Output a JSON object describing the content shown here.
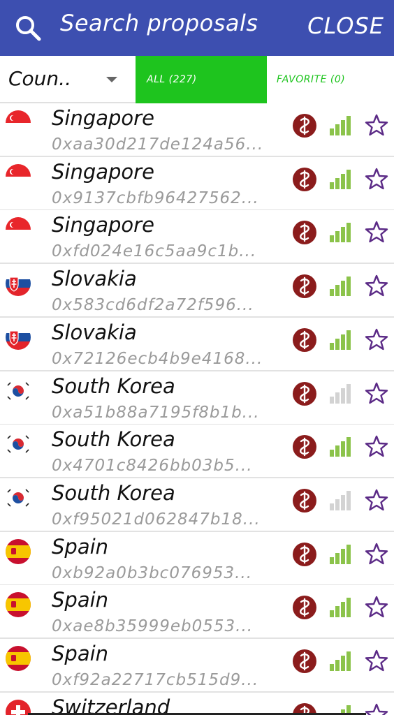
{
  "header": {
    "title": "Search proposals",
    "close_label": "CLOSE",
    "bg_color": "#3d4fb0"
  },
  "filters": {
    "country_select": "Coun..",
    "tab_all": "ALL (227)",
    "tab_favorite": "FAVORITE (0)",
    "active_color": "#1ec41e"
  },
  "proposals": [
    {
      "country": "Singapore",
      "address": "0xaa30d217de124a56...",
      "flag": "singapore",
      "signal_level": 4,
      "favorite": false
    },
    {
      "country": "Singapore",
      "address": "0x9137cbfb96427562...",
      "flag": "singapore",
      "signal_level": 4,
      "favorite": false
    },
    {
      "country": "Singapore",
      "address": "0xfd024e16c5aa9c1b...",
      "flag": "singapore",
      "signal_level": 4,
      "favorite": false
    },
    {
      "country": "Slovakia",
      "address": "0x583cd6df2a72f596...",
      "flag": "slovakia",
      "signal_level": 4,
      "favorite": false
    },
    {
      "country": "Slovakia",
      "address": "0x72126ecb4b9e4168...",
      "flag": "slovakia",
      "signal_level": 4,
      "favorite": false
    },
    {
      "country": "South Korea",
      "address": "0xa51b88a7195f8b1b...",
      "flag": "south-korea",
      "signal_level": 0,
      "favorite": false
    },
    {
      "country": "South Korea",
      "address": "0x4701c8426bb03b5...",
      "flag": "south-korea",
      "signal_level": 4,
      "favorite": false
    },
    {
      "country": "South Korea",
      "address": "0xf95021d062847b18...",
      "flag": "south-korea",
      "signal_level": 0,
      "favorite": false
    },
    {
      "country": "Spain",
      "address": "0xb92a0b3bc076953...",
      "flag": "spain",
      "signal_level": 4,
      "favorite": false
    },
    {
      "country": "Spain",
      "address": "0xae8b35999eb0553...",
      "flag": "spain",
      "signal_level": 4,
      "favorite": false
    },
    {
      "country": "Spain",
      "address": "0xf92a22717cb515d9...",
      "flag": "spain",
      "signal_level": 4,
      "favorite": false
    },
    {
      "country": "Switzerland",
      "address": "",
      "flag": "switzerland",
      "signal_level": 4,
      "favorite": false
    }
  ],
  "icons": {
    "search": "search-icon",
    "protocol": "openvpn-icon",
    "signal": "signal-strength-icon",
    "star": "star-outline-icon",
    "signal_on_color": "#8bc34a",
    "signal_off_color": "#d3d3d3",
    "protocol_color": "#8b1c1c",
    "star_color": "#5b2a86"
  }
}
